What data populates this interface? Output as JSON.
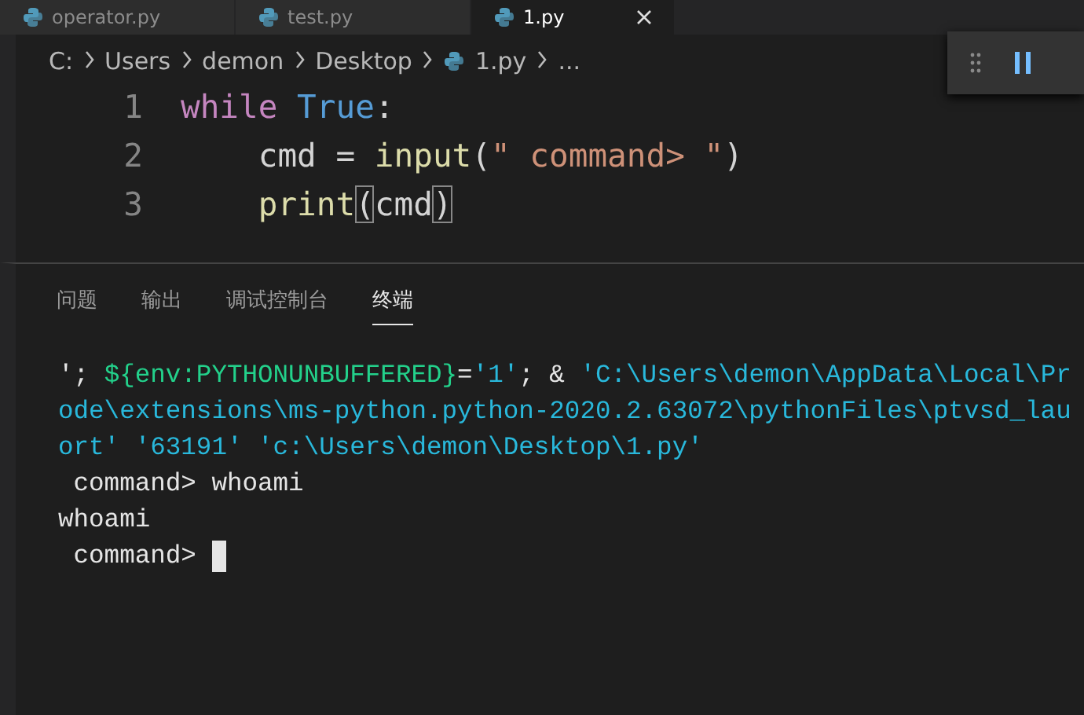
{
  "editor_tabs": [
    {
      "label": "operator.py",
      "selected": false
    },
    {
      "label": "test.py",
      "selected": false
    },
    {
      "label": "1.py",
      "selected": true
    }
  ],
  "breadcrumb": [
    {
      "label": "C:",
      "kind": "folder"
    },
    {
      "label": "Users",
      "kind": "folder"
    },
    {
      "label": "demon",
      "kind": "folder"
    },
    {
      "label": "Desktop",
      "kind": "folder"
    },
    {
      "label": "1.py",
      "kind": "file"
    },
    {
      "label": "...",
      "kind": "more"
    }
  ],
  "code_lines": [
    {
      "number": "1",
      "tokens": [
        {
          "text": "while",
          "kind": "keyword"
        },
        {
          "text": " True",
          "kind": "constant"
        },
        {
          "text": ":",
          "kind": "plain"
        }
      ]
    },
    {
      "number": "2",
      "tokens": [
        {
          "text": "    cmd = ",
          "kind": "plain"
        },
        {
          "text": "input",
          "kind": "function"
        },
        {
          "text": "(",
          "kind": "plain"
        },
        {
          "text": "\" command> \"",
          "kind": "string"
        },
        {
          "text": ")",
          "kind": "plain"
        }
      ]
    },
    {
      "number": "3",
      "tokens": [
        {
          "text": "    print",
          "kind": "function"
        },
        {
          "text": "(",
          "kind": "bracket"
        },
        {
          "text": "cmd",
          "kind": "plain"
        },
        {
          "text": ")",
          "kind": "bracket"
        }
      ]
    }
  ],
  "panel_tabs": [
    {
      "label": "问题",
      "selected": false
    },
    {
      "label": "输出",
      "selected": false
    },
    {
      "label": "调试控制台",
      "selected": false
    },
    {
      "label": "终端",
      "selected": true
    }
  ],
  "terminal_lines": [
    {
      "segments": [
        {
          "text": "'; ",
          "kind": "plain"
        },
        {
          "text": "${env:PYTHONUNBUFFERED}",
          "kind": "variable"
        },
        {
          "text": "=",
          "kind": "plain"
        },
        {
          "text": "'1'",
          "kind": "string"
        },
        {
          "text": "; & ",
          "kind": "plain"
        },
        {
          "text": "'C:\\Users\\demon\\AppData\\Local\\Pr",
          "kind": "string"
        }
      ]
    },
    {
      "segments": [
        {
          "text": "ode\\extensions\\ms-python.python-2020.2.63072\\pythonFiles\\ptvsd_lau",
          "kind": "string"
        }
      ]
    },
    {
      "segments": [
        {
          "text": "ort' '63191' 'c:\\Users\\demon\\Desktop\\1.py'",
          "kind": "string"
        }
      ]
    },
    {
      "segments": [
        {
          "text": " command> whoami",
          "kind": "plain"
        }
      ]
    },
    {
      "segments": [
        {
          "text": "whoami",
          "kind": "plain"
        }
      ]
    },
    {
      "segments": [
        {
          "text": " command> ",
          "kind": "plain"
        }
      ],
      "cursor": true
    }
  ]
}
